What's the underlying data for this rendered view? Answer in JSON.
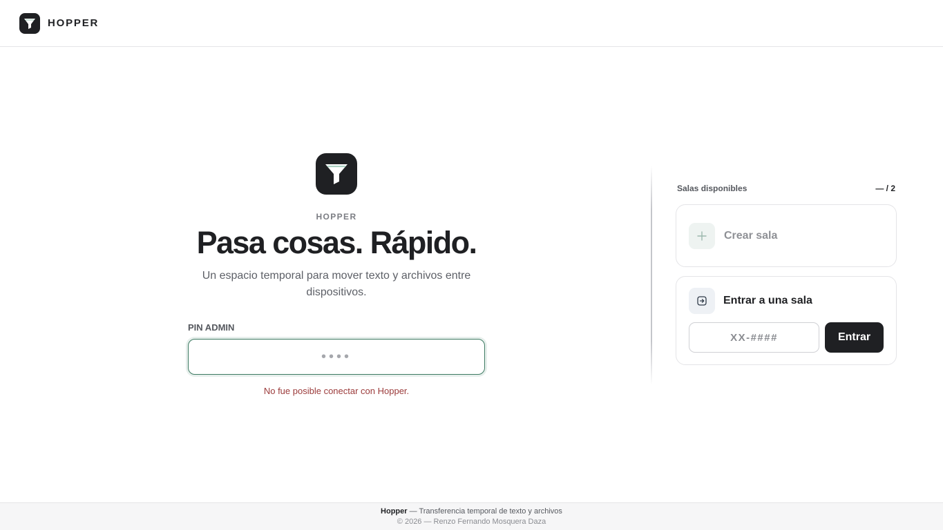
{
  "colors": {
    "brand": "#1f2023",
    "accent_focus": "#3d7a62",
    "error": "#9b3a3a",
    "funnel_highlight": "#a9cfc0"
  },
  "header": {
    "logo_icon": "funnel-icon",
    "brand_name": "HOPPER"
  },
  "hero": {
    "logo_icon": "funnel-icon",
    "eyebrow": "HOPPER",
    "headline": "Pasa cosas. Rápido.",
    "subtitle": "Un espacio temporal para mover texto y archivos entre dispositivos."
  },
  "pin": {
    "label": "PIN ADMIN",
    "value": "",
    "placeholder": "••••",
    "error": "No fue posible conectar con Hopper."
  },
  "rooms": {
    "title": "Salas disponibles",
    "count": "— / 2",
    "create": {
      "icon": "plus-icon",
      "label": "Crear sala"
    },
    "join": {
      "icon": "enter-icon",
      "label": "Entrar a una sala",
      "code_value": "",
      "code_placeholder": "XX-####",
      "button_label": "Entrar"
    }
  },
  "footer": {
    "app_name": "Hopper",
    "tagline": " — Transferencia temporal de texto y archivos",
    "copyright": "© 2026 — Renzo Fernando Mosquera Daza"
  }
}
